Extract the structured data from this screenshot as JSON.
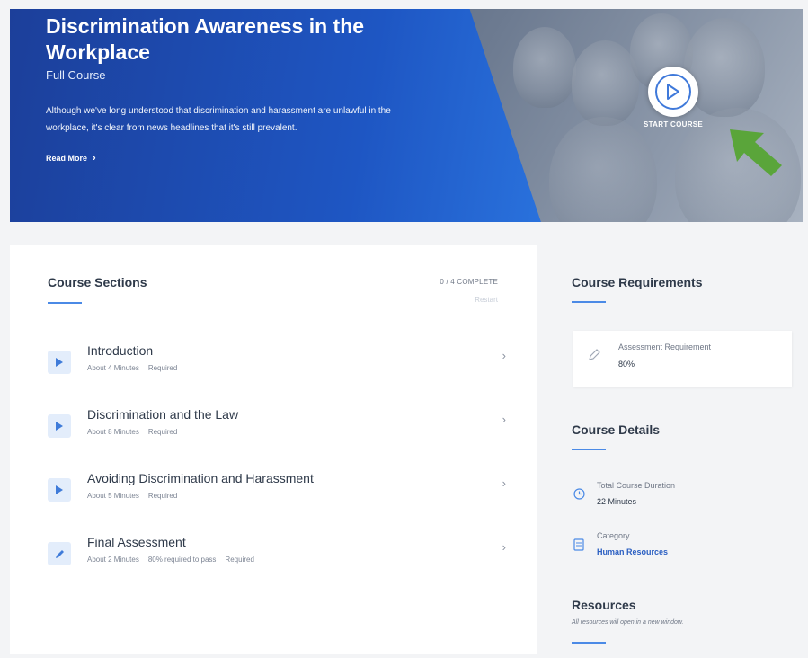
{
  "hero": {
    "title": "Discrimination Awareness in the Workplace",
    "subtitle": "Full Course",
    "description": "Although we've long understood that discrimination and harassment are unlawful in the workplace, it's clear from news headlines that it's still prevalent.",
    "read_more": "Read More",
    "start_label": "START COURSE",
    "accent_color": "#1e56c3"
  },
  "sections": {
    "heading": "Course Sections",
    "complete": "0 / 4 COMPLETE",
    "complete_sub": "Restart",
    "items": [
      {
        "title": "Introduction",
        "duration": "About 4 Minutes",
        "extra": "",
        "required": "Required",
        "icon": "play-icon"
      },
      {
        "title": "Discrimination and the Law",
        "duration": "About 8 Minutes",
        "extra": "",
        "required": "Required",
        "icon": "play-icon"
      },
      {
        "title": "Avoiding Discrimination and Harassment",
        "duration": "About 5 Minutes",
        "extra": "",
        "required": "Required",
        "icon": "play-icon"
      },
      {
        "title": "Final Assessment",
        "duration": "About 2 Minutes",
        "extra": "80% required to pass",
        "required": "Required",
        "icon": "pencil-icon"
      }
    ]
  },
  "sidebar": {
    "requirements_heading": "Course Requirements",
    "assessment_label": "Assessment Requirement",
    "assessment_value": "80%",
    "details_heading": "Course Details",
    "duration_label": "Total Course Duration",
    "duration_value": "22 Minutes",
    "category_label": "Category",
    "category_value": "Human Resources",
    "resources_heading": "Resources",
    "resources_note": "All resources will open in a new window."
  }
}
